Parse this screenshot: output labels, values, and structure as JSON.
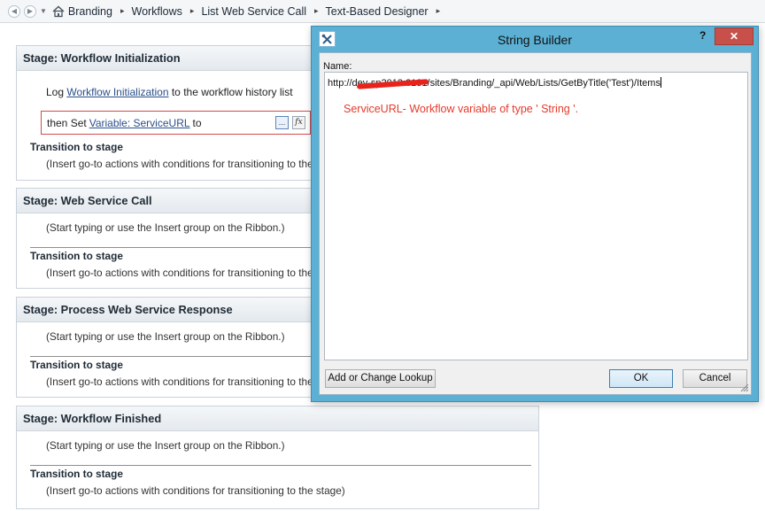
{
  "breadcrumb": {
    "items": [
      "Branding",
      "Workflows",
      "List Web Service Call",
      "Text-Based Designer"
    ],
    "separator": "▸"
  },
  "stages": [
    {
      "title": "Stage: Workflow Initialization",
      "log_prefix": "Log ",
      "log_link": "Workflow Initialization",
      "log_suffix": " to the workflow history list",
      "set_prefix": "then Set ",
      "set_link": "Variable: ServiceURL",
      "set_suffix": " to",
      "ellipsis": "...",
      "fx": "fx",
      "transition_label": "Transition to stage",
      "transition_hint": "(Insert go-to actions with conditions for transitioning to the stage)"
    },
    {
      "title": "Stage: Web Service Call",
      "hint": "(Start typing or use the Insert group on the Ribbon.)",
      "transition_label": "Transition to stage",
      "transition_hint": "(Insert go-to actions with conditions for transitioning to the stage)"
    },
    {
      "title": "Stage: Process Web Service Response",
      "hint": "(Start typing or use the Insert group on the Ribbon.)",
      "transition_label": "Transition to stage",
      "transition_hint": "(Insert go-to actions with conditions for transitioning to the stage)"
    },
    {
      "title": "Stage: Workflow Finished",
      "hint": "(Start typing or use the Insert group on the Ribbon.)",
      "transition_label": "Transition to stage",
      "transition_hint": "(Insert go-to actions with conditions for transitioning to the stage)"
    }
  ],
  "dialog": {
    "title": "String Builder",
    "help": "?",
    "close": "✕",
    "name_label": "Name:",
    "url_start": "http://d",
    "url_redacted": "ev-sp2013:8181",
    "url_end": "/sites/Branding/_api/Web/Lists/GetByTitle('Test')/Items",
    "annotation": "ServiceURL- Workflow variable of type ' String '.",
    "lookup_button": "Add or Change Lookup",
    "ok_button": "OK",
    "cancel_button": "Cancel"
  },
  "colors": {
    "dialog_frame": "#5bb0d4",
    "close_button": "#c7504a",
    "annotation": "#e43a2c",
    "highlight_border": "#d34a4a"
  }
}
